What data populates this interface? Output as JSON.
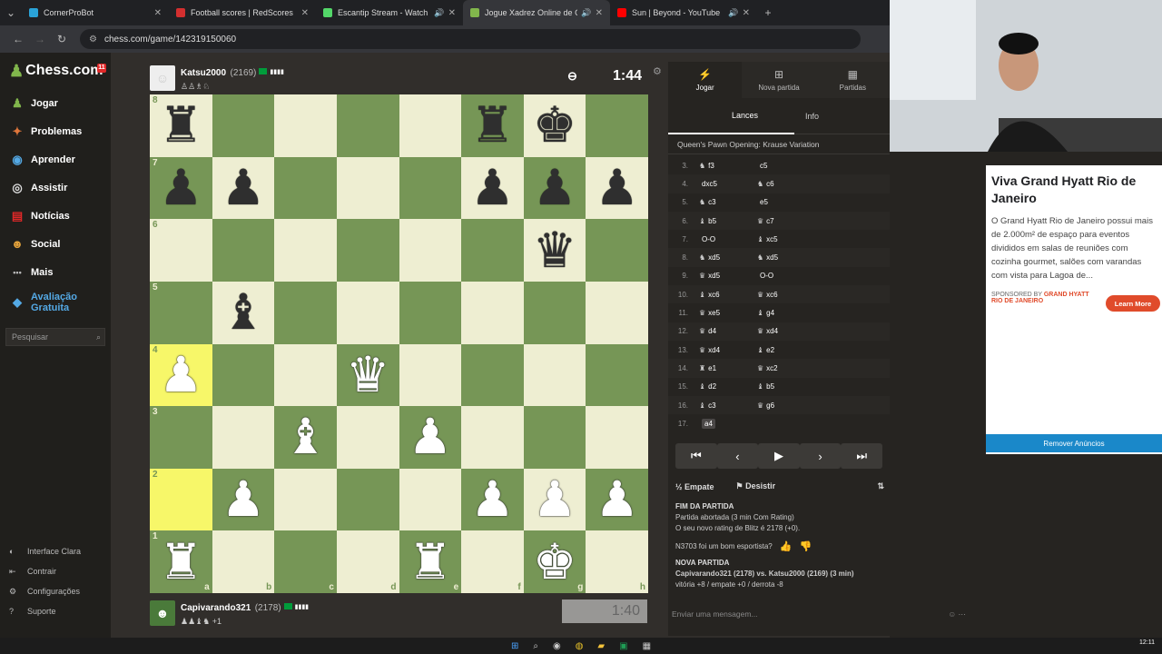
{
  "browser": {
    "tabs": [
      {
        "title": "CornerProBot",
        "color": "#2aa3d8",
        "audio": false
      },
      {
        "title": "Football scores | RedScores",
        "color": "#d32f2f",
        "audio": false
      },
      {
        "title": "Escantip Stream - Watch Live",
        "color": "#53d769",
        "audio": true
      },
      {
        "title": "Jogue Xadrez Online de Graça",
        "color": "#81b64c",
        "audio": true,
        "active": true
      },
      {
        "title": "Sun | Beyond - YouTube",
        "color": "#ff0000",
        "audio": true
      }
    ],
    "url": "chess.com/game/142319150060"
  },
  "sidebar": {
    "logo": "Chess.com",
    "notification_count": "11",
    "items": [
      {
        "label": "Jogar",
        "icon": "play-icon"
      },
      {
        "label": "Problemas",
        "icon": "puzzle-icon"
      },
      {
        "label": "Aprender",
        "icon": "learn-icon"
      },
      {
        "label": "Assistir",
        "icon": "watch-icon"
      },
      {
        "label": "Notícias",
        "icon": "news-icon"
      },
      {
        "label": "Social",
        "icon": "social-icon"
      },
      {
        "label": "Mais",
        "icon": "more-icon"
      }
    ],
    "premium_label": "Avaliação Gratuita",
    "search_placeholder": "Pesquisar",
    "bottom": [
      {
        "label": "Interface Clara",
        "icon": "contrast-icon"
      },
      {
        "label": "Contrair",
        "icon": "collapse-icon"
      },
      {
        "label": "Configurações",
        "icon": "settings-icon"
      },
      {
        "label": "Suporte",
        "icon": "support-icon"
      }
    ]
  },
  "top_player": {
    "name": "Katsu2000",
    "rating": "(2169)",
    "captured": "♙♙♗♘",
    "clock": "1:44"
  },
  "bottom_player": {
    "name": "Capivarando321",
    "rating": "(2178)",
    "captured": "♟♟♝♞",
    "bonus": "+1",
    "clock": "1:40"
  },
  "board": {
    "ranks": [
      "8",
      "7",
      "6",
      "5",
      "4",
      "3",
      "2",
      "1"
    ],
    "files": [
      "a",
      "b",
      "c",
      "d",
      "e",
      "f",
      "g",
      "h"
    ],
    "position": [
      [
        "br",
        "",
        "",
        "",
        "",
        "br",
        "bk",
        ""
      ],
      [
        "bp",
        "bp",
        "",
        "",
        "",
        "bp",
        "bp",
        "bp"
      ],
      [
        "",
        "",
        "",
        "",
        "",
        "",
        "bq",
        ""
      ],
      [
        "",
        "bb",
        "",
        "",
        "",
        "",
        "",
        ""
      ],
      [
        "wp",
        "",
        "",
        "wq",
        "",
        "",
        "",
        ""
      ],
      [
        "",
        "",
        "wb",
        "",
        "wp",
        "",
        "",
        ""
      ],
      [
        "",
        "wp",
        "",
        "",
        "",
        "wp",
        "wp",
        "wp"
      ],
      [
        "wr",
        "",
        "",
        "",
        "wr",
        "",
        "wk",
        ""
      ]
    ],
    "highlights": [
      "a4",
      "a2"
    ]
  },
  "panel": {
    "tabs": [
      {
        "label": "Jogar",
        "icon": "lightning-icon"
      },
      {
        "label": "Nova partida",
        "icon": "new-game-icon"
      },
      {
        "label": "Partidas",
        "icon": "board-icon"
      }
    ],
    "subtabs": [
      "Lances",
      "Info"
    ],
    "opening": "Queen's Pawn Opening: Krause Variation",
    "moves": [
      {
        "n": "3.",
        "w": "f3",
        "wp": "♞",
        "b": "c5",
        "bp": ""
      },
      {
        "n": "4.",
        "w": "dxc5",
        "wp": "",
        "b": "c6",
        "bp": "♞"
      },
      {
        "n": "5.",
        "w": "c3",
        "wp": "♞",
        "b": "e5",
        "bp": ""
      },
      {
        "n": "6.",
        "w": "b5",
        "wp": "♝",
        "b": "c7",
        "bp": "♛"
      },
      {
        "n": "7.",
        "w": "O-O",
        "wp": "",
        "b": "xc5",
        "bp": "♝"
      },
      {
        "n": "8.",
        "w": "xd5",
        "wp": "♞",
        "b": "xd5",
        "bp": "♞"
      },
      {
        "n": "9.",
        "w": "xd5",
        "wp": "♛",
        "b": "O-O",
        "bp": ""
      },
      {
        "n": "10.",
        "w": "xc6",
        "wp": "♝",
        "b": "xc6",
        "bp": "♛"
      },
      {
        "n": "11.",
        "w": "xe5",
        "wp": "♛",
        "b": "g4",
        "bp": "♝"
      },
      {
        "n": "12.",
        "w": "d4",
        "wp": "♛",
        "b": "xd4",
        "bp": "♛"
      },
      {
        "n": "13.",
        "w": "xd4",
        "wp": "♛",
        "b": "e2",
        "bp": "♝"
      },
      {
        "n": "14.",
        "w": "e1",
        "wp": "♜",
        "b": "xc2",
        "bp": "♛"
      },
      {
        "n": "15.",
        "w": "d2",
        "wp": "♝",
        "b": "b5",
        "bp": "♝"
      },
      {
        "n": "16.",
        "w": "c3",
        "wp": "♝",
        "b": "g6",
        "bp": "♛"
      },
      {
        "n": "17.",
        "w": "a4",
        "wp": "",
        "b": "",
        "bp": "",
        "current": true
      }
    ],
    "actions": {
      "draw": "Empate",
      "resign": "Desistir"
    },
    "chat": {
      "end_title": "FIM DA PARTIDA",
      "end_line1": "Partida abortada (3 min Com Rating)",
      "end_line2": "O seu novo rating de Blitz é 2178 (+0).",
      "sport_q": "N3703 foi um bom esportista?",
      "new_title": "NOVA PARTIDA",
      "new_line1": "Capivarando321 (2178) vs. Katsu2000 (2169) (3 min)",
      "new_line2": "vitória +8 / empate +0 / derrota -8",
      "input_placeholder": "Enviar uma mensagem..."
    }
  },
  "ad": {
    "title": "Viva Grand Hyatt Rio de Janeiro",
    "body": "O Grand Hyatt Rio de Janeiro possui mais de 2.000m² de espaço para eventos divididos em salas de reuniões com cozinha gourmet, salões com varandas com vista para Lagoa de...",
    "sponsor_prefix": "SPONSORED BY",
    "sponsor": "GRAND HYATT RIO DE JANEIRO",
    "cta": "Learn More",
    "remove": "Remover Anúncios"
  },
  "taskbar": {
    "time": "12:11"
  }
}
